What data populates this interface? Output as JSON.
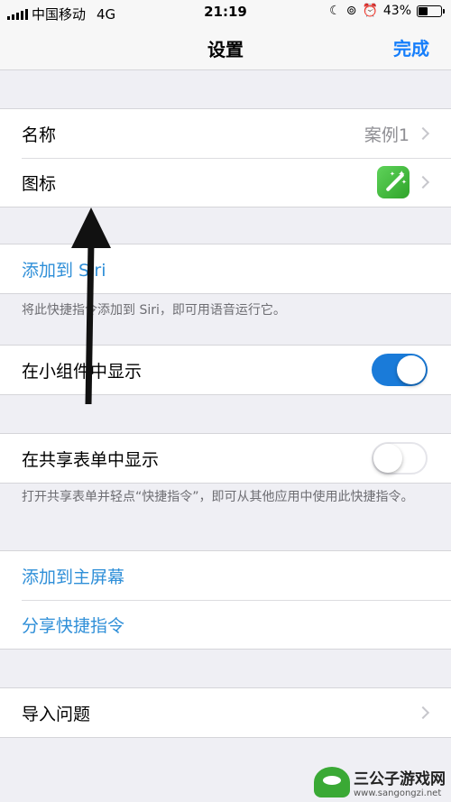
{
  "status_bar": {
    "carrier": "中国移动",
    "network": "4G",
    "time": "21:19",
    "battery": "43%",
    "battery_level": 0.43
  },
  "nav": {
    "title": "设置",
    "done": "完成"
  },
  "name_row": {
    "label": "名称",
    "value": "案例1"
  },
  "icon_row": {
    "label": "图标",
    "icon_color": "#3fb83a"
  },
  "siri": {
    "label": "添加到 Siri",
    "note": "将此快捷指令添加到 Siri，即可用语音运行它。"
  },
  "widget": {
    "label": "在小组件中显示",
    "on": true
  },
  "share_sheet": {
    "label": "在共享表单中显示",
    "on": false,
    "note": "打开共享表单并轻点“快捷指令”，即可从其他应用中使用此快捷指令。"
  },
  "actions": {
    "home_screen": "添加到主屏幕",
    "share": "分享快捷指令"
  },
  "import": {
    "label": "导入问题"
  },
  "watermark": {
    "title": "三公子游戏网",
    "url": "www.sangongzi.net"
  },
  "colors": {
    "accent": "#157efb",
    "toggle_on": "#1a7bd9",
    "link": "#2f8fd8"
  }
}
